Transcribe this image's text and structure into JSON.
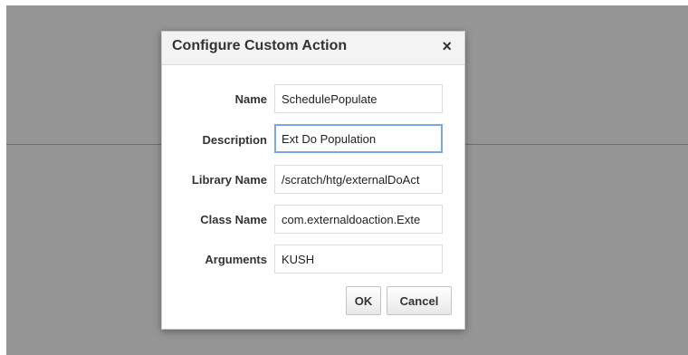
{
  "dialog": {
    "title": "Configure Custom Action",
    "close_glyph": "×",
    "close_icon": "close-icon"
  },
  "form": {
    "name": {
      "label": "Name",
      "value": "SchedulePopulate"
    },
    "description": {
      "label": "Description",
      "value": "Ext Do Population"
    },
    "library_name": {
      "label": "Library Name",
      "value": "/scratch/htg/externalDoAct"
    },
    "class_name": {
      "label": "Class Name",
      "value": "com.externaldoaction.Exte"
    },
    "arguments": {
      "label": "Arguments",
      "value": "KUSH"
    }
  },
  "buttons": {
    "ok_label": "OK",
    "cancel_label": "Cancel"
  },
  "colors": {
    "overlay": "#959595",
    "focus_border": "#7aa7e6"
  }
}
